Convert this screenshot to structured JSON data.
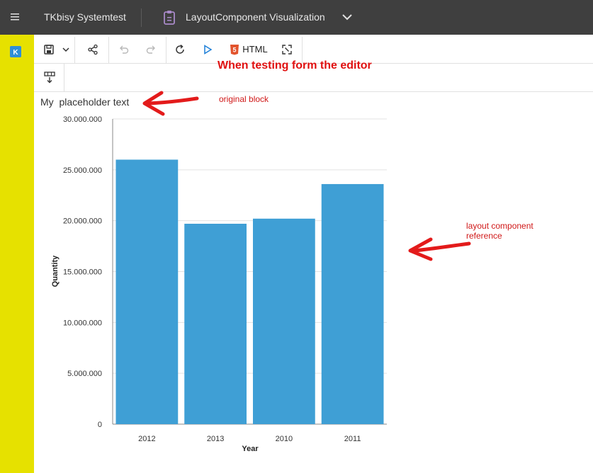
{
  "topbar": {
    "app_title": "TKbisy Systemtest",
    "doc_title": "LayoutComponent Visualization"
  },
  "toolbar": {
    "html_label": "HTML"
  },
  "annotations": {
    "editor_note": "When testing form the editor",
    "original_block": "original block",
    "layout_ref_line1": "layout component",
    "layout_ref_line2": "reference"
  },
  "content": {
    "placeholder": "My  placeholder text"
  },
  "colors": {
    "topbar": "#3f3f3f",
    "sidebar": "#e6e100",
    "bar": "#3f9fd5",
    "annotation": "#e01010",
    "play_icon": "#1d7fd8",
    "html5_icon": "#e2532d"
  },
  "icons": [
    "hamburger-menu-icon",
    "clipboard-icon",
    "chevron-down-icon",
    "app-logo-icon",
    "save-icon",
    "share-icon",
    "undo-icon",
    "redo-icon",
    "refresh-icon",
    "play-icon",
    "html5-icon",
    "expand-icon",
    "insert-row-icon",
    "arrow-left-icon"
  ],
  "chart_data": {
    "type": "bar",
    "categories": [
      "2012",
      "2013",
      "2010",
      "2011"
    ],
    "values": [
      26000000,
      19700000,
      20200000,
      23600000
    ],
    "xlabel": "Year",
    "ylabel": "Quantity",
    "ylim": [
      0,
      30000000
    ],
    "yticks": [
      "0",
      "5.000.000",
      "10.000.000",
      "15.000.000",
      "20.000.000",
      "25.000.000",
      "30.000.000"
    ],
    "grid": true
  }
}
